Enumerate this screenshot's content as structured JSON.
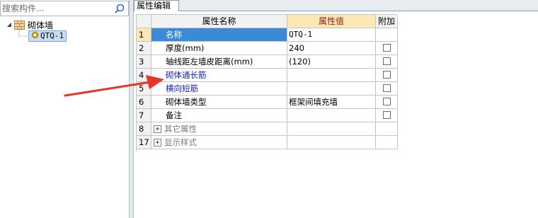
{
  "search": {
    "placeholder": "搜索构件..."
  },
  "tree": {
    "root_label": "砌体墙",
    "child_label": "QTQ-1"
  },
  "tab": {
    "label": "属性编辑"
  },
  "table": {
    "headers": {
      "name": "属性名称",
      "value": "属性值",
      "extra": "附加"
    },
    "rows": [
      {
        "num": "1",
        "name": "名称",
        "value": "QTQ-1",
        "checkbox": false,
        "style": "selected"
      },
      {
        "num": "2",
        "name": "厚度(mm)",
        "value": "240",
        "checkbox": true,
        "style": "normal"
      },
      {
        "num": "3",
        "name": "轴线距左墙皮距离(mm)",
        "value": "(120)",
        "checkbox": true,
        "style": "normal"
      },
      {
        "num": "4",
        "name": "砌体通长筋",
        "value": "",
        "checkbox": true,
        "style": "blue"
      },
      {
        "num": "5",
        "name": "横向短筋",
        "value": "",
        "checkbox": true,
        "style": "blue"
      },
      {
        "num": "6",
        "name": "砌体墙类型",
        "value": "框架间填充墙",
        "checkbox": true,
        "style": "normal"
      },
      {
        "num": "7",
        "name": "备注",
        "value": "",
        "checkbox": true,
        "style": "normal"
      },
      {
        "num": "8",
        "name": "其它属性",
        "value": "",
        "checkbox": false,
        "style": "group"
      },
      {
        "num": "17",
        "name": "显示样式",
        "value": "",
        "checkbox": false,
        "style": "group"
      }
    ]
  },
  "annotation": {
    "arrow_color": "#e8332a"
  }
}
